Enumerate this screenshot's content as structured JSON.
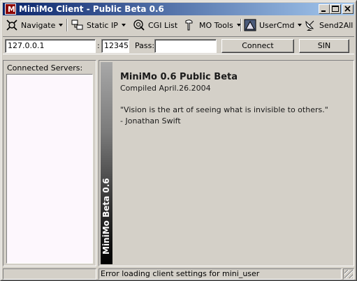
{
  "window": {
    "title": "MiniMo Client - Public Beta 0.6",
    "icon_letter": "M"
  },
  "toolbar": {
    "navigate": "Navigate",
    "static_ip": "Static IP",
    "cgi_list": "CGI List",
    "mo_tools": "MO Tools",
    "usercmd": "UserCmd",
    "send2all": "Send2All"
  },
  "connection": {
    "ip_value": "127.0.0.1",
    "port_separator": ":",
    "port_value": "12345",
    "pass_label": "Pass:",
    "pass_value": "",
    "connect_label": "Connect",
    "sin_label": "SIN"
  },
  "servers": {
    "header": "Connected Servers:"
  },
  "main": {
    "strip_text": "MiniMo Beta 0.6",
    "app_title": "MiniMo 0.6 Public Beta",
    "compiled": "Compiled April.26.2004",
    "quote": "\"Vision is the art of seeing what is invisible to others.\"",
    "author": "- Jonathan Swift"
  },
  "status": {
    "message": "Error loading client settings for mini_user"
  },
  "colors": {
    "title_start": "#0a246a",
    "title_end": "#a6caf0",
    "face": "#d4d0c8",
    "list_bg": "#fdf7fd"
  }
}
